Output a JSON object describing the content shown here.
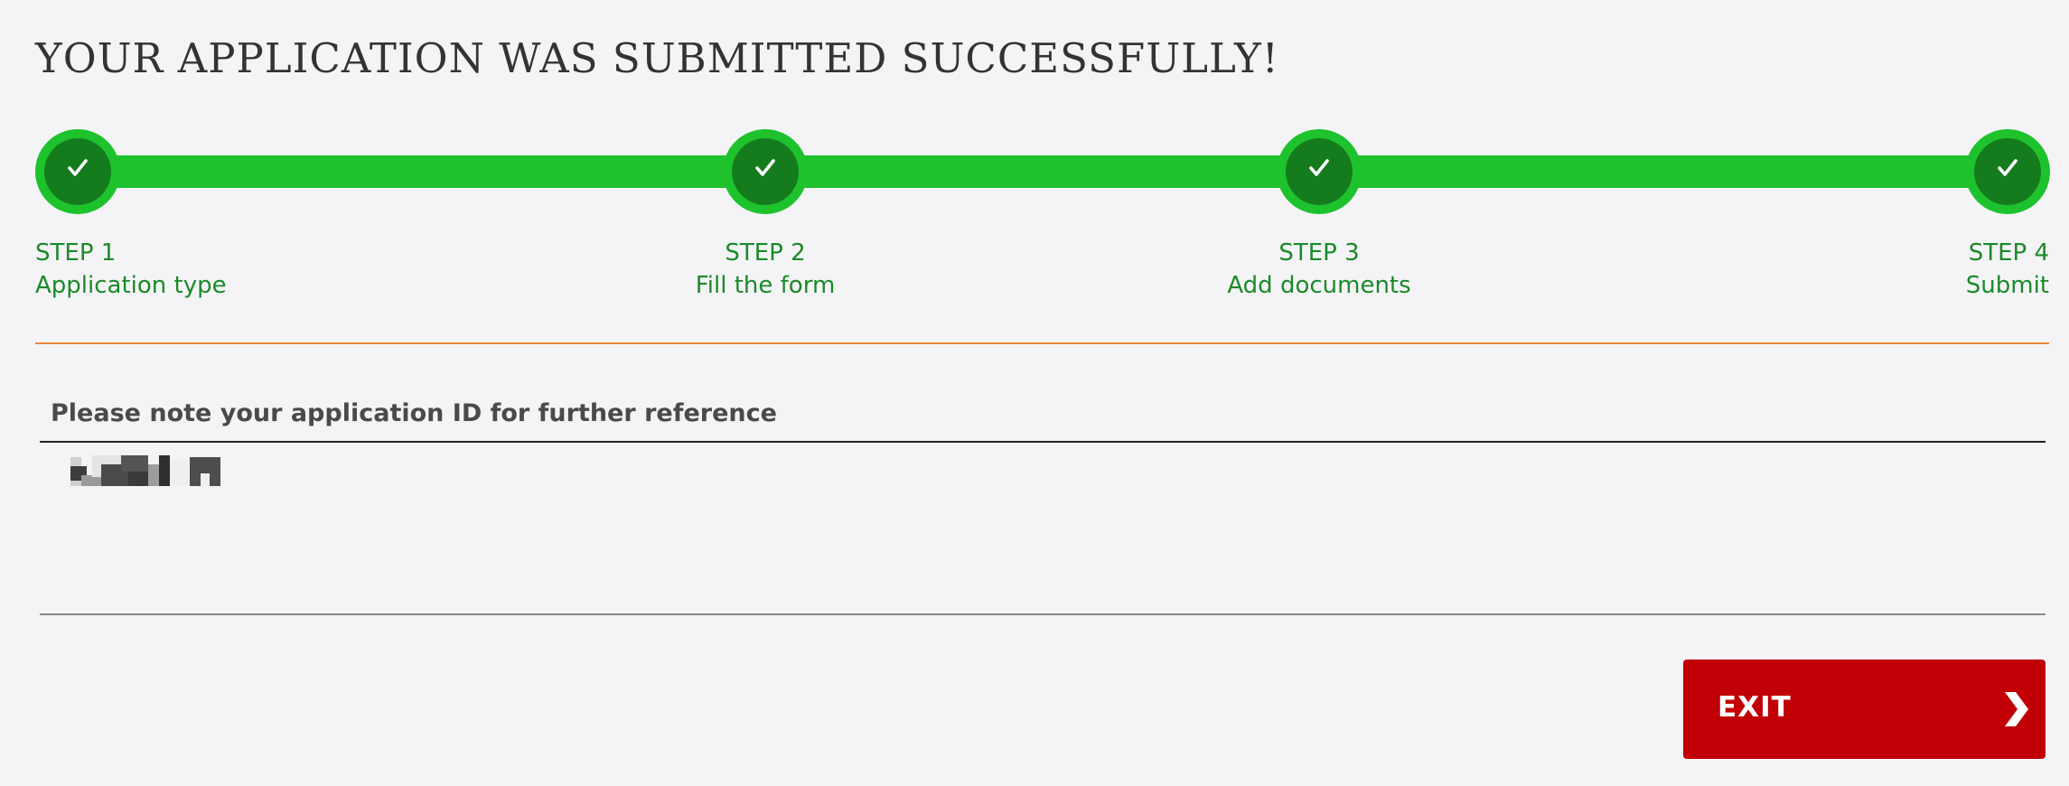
{
  "header": {
    "title": "YOUR APPLICATION WAS SUBMITTED SUCCESSFULLY!"
  },
  "stepper": {
    "status": "complete",
    "colors": {
      "track": "#1ec22d",
      "node_inner": "#157c1e",
      "label": "#1a8a28"
    },
    "steps": [
      {
        "num": "STEP 1",
        "name": "Application type",
        "state": "done",
        "icon": "checkmark-icon"
      },
      {
        "num": "STEP 2",
        "name": "Fill the form",
        "state": "done",
        "icon": "checkmark-icon"
      },
      {
        "num": "STEP 3",
        "name": "Add documents",
        "state": "done",
        "icon": "checkmark-icon"
      },
      {
        "num": "STEP 4",
        "name": "Submit",
        "state": "done",
        "icon": "checkmark-icon"
      }
    ]
  },
  "application_id": {
    "label": "Please note your application ID for further reference",
    "value_redacted": true
  },
  "actions": {
    "exit_label": "EXIT",
    "exit_icon": "chevron-right-icon",
    "exit_color": "#c10006"
  }
}
